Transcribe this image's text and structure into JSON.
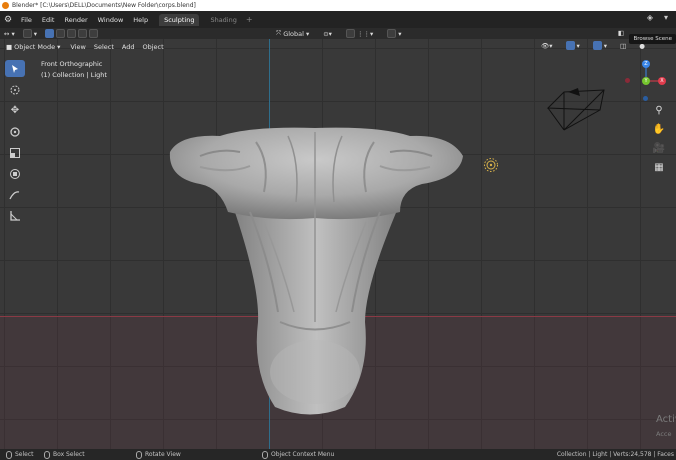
{
  "titlebar": {
    "title": "Blender* [C:\\Users\\DELL\\Documents\\New Folder\\corps.blend]"
  },
  "menubar": {
    "menus": [
      "File",
      "Edit",
      "Render",
      "Window",
      "Help"
    ],
    "workspace_tabs": [
      {
        "label": "Sculpting",
        "active": true
      },
      {
        "label": "Shading",
        "active": false
      }
    ],
    "add_tab": "+"
  },
  "header": {
    "orientation": "Global"
  },
  "viewport_menu": {
    "mode": "Object Mode",
    "items": [
      "View",
      "Select",
      "Add",
      "Object"
    ]
  },
  "tooltip": {
    "text": "Browse Scene"
  },
  "viewport": {
    "view_name": "Front Orthographic",
    "collection": "(1) Collection | Light"
  },
  "gizmo": {
    "z_label": "Z",
    "y_label": "Y",
    "x_label": "X"
  },
  "statusbar": {
    "select": "Select",
    "box_select": "Box Select",
    "rotate_view": "Rotate View",
    "context_menu": "Object Context Menu",
    "info": "Collection | Light | Verts:24,578 | Faces"
  },
  "watermark": {
    "line1": "Activ",
    "line2": "Acce"
  },
  "colors": {
    "accent_blue": "#4772b3",
    "axis_x": "#8a3a45",
    "axis_z": "#2f6e8c",
    "gizmo_x": "#e03b4c",
    "gizmo_y": "#75c52e",
    "gizmo_z": "#3a86e8"
  }
}
